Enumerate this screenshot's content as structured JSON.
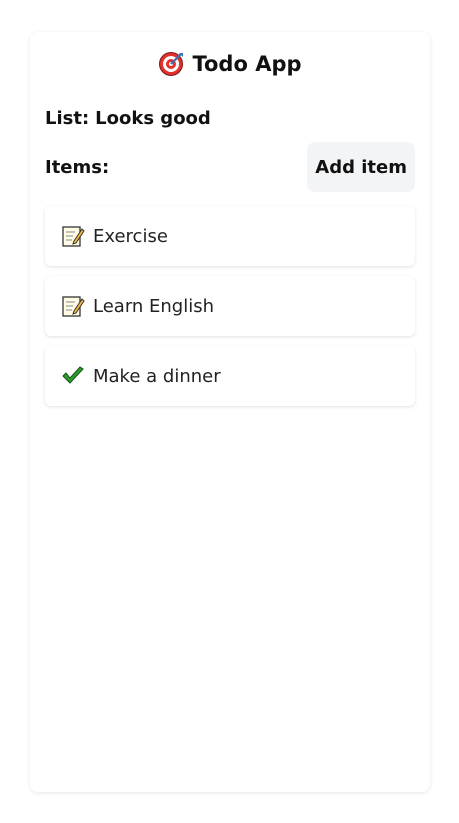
{
  "app": {
    "title": "Todo App",
    "icon": "target-icon"
  },
  "list": {
    "prefix": "List:",
    "name": "Looks good"
  },
  "items_header": {
    "label": "Items:",
    "add_label": "Add item"
  },
  "todos": [
    {
      "label": "Exercise",
      "icon": "memo-icon",
      "done": false
    },
    {
      "label": "Learn English",
      "icon": "memo-icon",
      "done": false
    },
    {
      "label": "Make a dinner",
      "icon": "check-mark-icon",
      "done": true
    }
  ],
  "colors": {
    "card_bg": "#ffffff",
    "button_bg": "#f3f4f6",
    "check_green": "#2e9b2e",
    "target_red": "#e0312f"
  }
}
